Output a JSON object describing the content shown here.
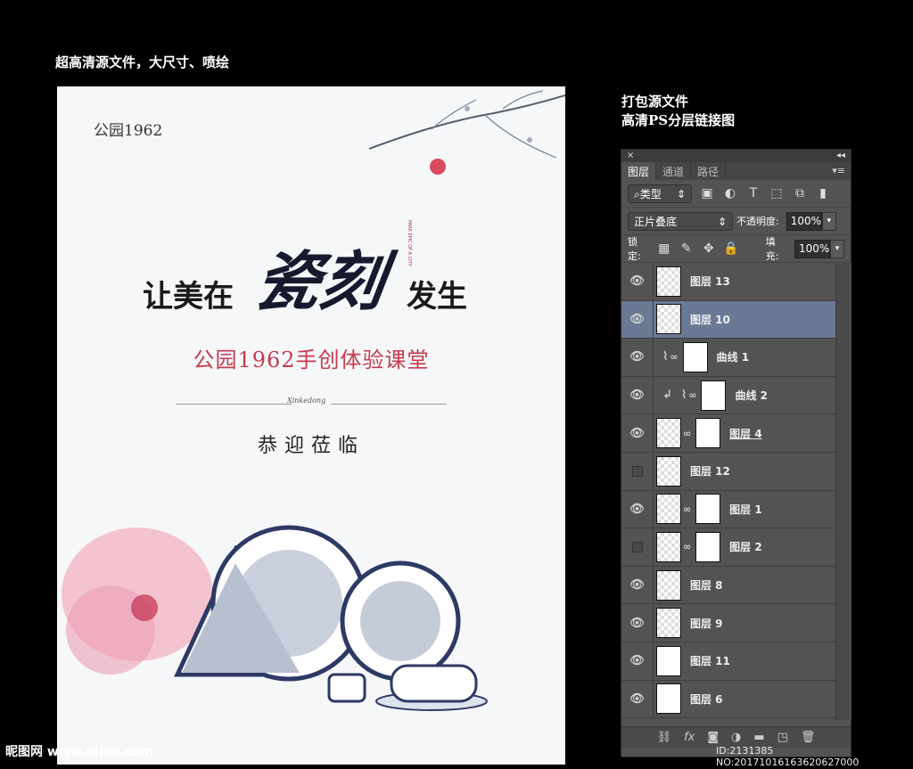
{
  "captions": {
    "left": "超高清源文件，大尺寸、喷绘",
    "right_line1": "打包源文件",
    "right_line2": "高清PS分层链接图"
  },
  "poster": {
    "logo": "公园1962",
    "headline_left": "让美在",
    "headline_big": "瓷刻",
    "headline_right": "发生",
    "seal": "PARK EPIC OF A CITY",
    "subtitle": "公园1962手创体验课堂",
    "divider_script": "Xinkedong",
    "welcome": "恭迎莅临"
  },
  "panel": {
    "tabs": [
      "图层",
      "通道",
      "路径"
    ],
    "filter_label": "类型",
    "blend_mode": "正片叠底",
    "opacity_label": "不透明度:",
    "opacity_value": "100%",
    "lock_label": "锁定:",
    "fill_label": "填充:",
    "fill_value": "100%",
    "layers": [
      {
        "name": "图层 13",
        "visible": true
      },
      {
        "name": "图层 10",
        "visible": true,
        "selected": true
      },
      {
        "name": "曲线 1",
        "visible": true
      },
      {
        "name": "曲线 2",
        "visible": true
      },
      {
        "name": "图层 4",
        "visible": true
      },
      {
        "name": "图层 12",
        "visible": false
      },
      {
        "name": "图层 1",
        "visible": true
      },
      {
        "name": "图层 2",
        "visible": false
      },
      {
        "name": "图层 8",
        "visible": true
      },
      {
        "name": "图层 9",
        "visible": true
      },
      {
        "name": "图层 11",
        "visible": true
      },
      {
        "name": "图层 6",
        "visible": true
      }
    ]
  },
  "watermark": {
    "site": "昵图网 www.nipic.com",
    "id": "ID:2131385 NO:20171016163620627000"
  }
}
